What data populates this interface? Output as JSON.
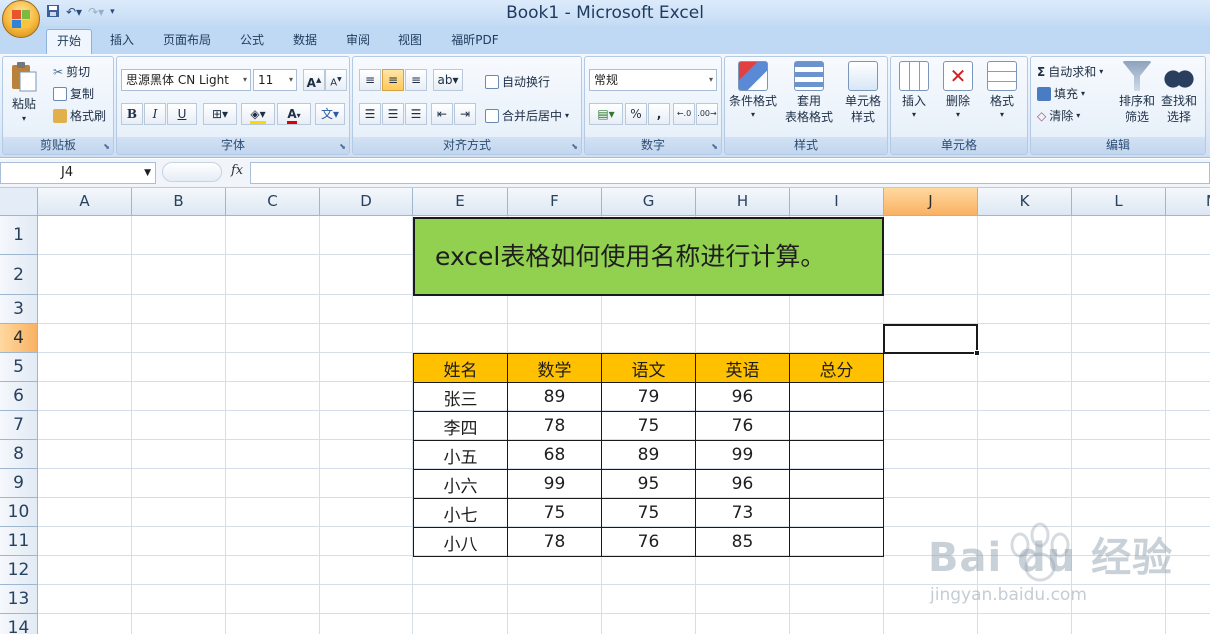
{
  "window": {
    "title": "Book1 - Microsoft Excel"
  },
  "tabs": [
    "开始",
    "插入",
    "页面布局",
    "公式",
    "数据",
    "审阅",
    "视图",
    "福昕PDF"
  ],
  "ribbon": {
    "clipboard": {
      "label": "剪贴板",
      "paste": "粘贴",
      "cut": "剪切",
      "copy": "复制",
      "format_painter": "格式刷"
    },
    "font": {
      "label": "字体",
      "font_name": "思源黑体 CN Light",
      "font_size": "11",
      "bold": "B",
      "italic": "I",
      "underline": "U",
      "grow": "A",
      "shrink": "A",
      "color_letter": "A"
    },
    "alignment": {
      "label": "对齐方式",
      "wrap_text": "自动换行",
      "merge_center": "合并后居中"
    },
    "number": {
      "label": "数字",
      "format": "常规",
      "percent": "%",
      "comma": ","
    },
    "styles": {
      "label": "样式",
      "conditional": "条件格式",
      "table_format_1": "套用",
      "table_format_2": "表格格式",
      "cell_styles_1": "单元格",
      "cell_styles_2": "样式"
    },
    "cells": {
      "label": "单元格",
      "insert": "插入",
      "delete": "删除",
      "format": "格式"
    },
    "editing": {
      "label": "编辑",
      "autosum": "自动求和",
      "fill": "填充",
      "clear": "清除",
      "sort_1": "排序和",
      "sort_2": "筛选",
      "find_1": "查找和",
      "find_2": "选择"
    }
  },
  "formula_bar": {
    "name_box": "J4",
    "fx": "fx",
    "value": ""
  },
  "grid": {
    "columns": [
      "A",
      "B",
      "C",
      "D",
      "E",
      "F",
      "G",
      "H",
      "I",
      "J",
      "K",
      "L",
      "M"
    ],
    "rows": [
      "1",
      "2",
      "3",
      "4",
      "5",
      "6",
      "7",
      "8",
      "9",
      "10",
      "11",
      "12",
      "13",
      "14"
    ],
    "selected_column": "J",
    "selected_row": "4"
  },
  "sheet": {
    "title": "excel表格如何使用名称进行计算。",
    "headers": [
      "姓名",
      "数学",
      "语文",
      "英语",
      "总分"
    ],
    "rows": [
      [
        "张三",
        "89",
        "79",
        "96",
        ""
      ],
      [
        "李四",
        "78",
        "75",
        "76",
        ""
      ],
      [
        "小五",
        "68",
        "89",
        "99",
        ""
      ],
      [
        "小六",
        "99",
        "95",
        "96",
        ""
      ],
      [
        "小七",
        "75",
        "75",
        "73",
        ""
      ],
      [
        "小八",
        "78",
        "76",
        "85",
        ""
      ]
    ]
  },
  "watermark": {
    "brand": "Bai du 经验",
    "url": "jingyan.baidu.com"
  },
  "colors": {
    "title_fill": "#92d050",
    "header_fill": "#ffc000",
    "selected_header": "#f9b162"
  }
}
